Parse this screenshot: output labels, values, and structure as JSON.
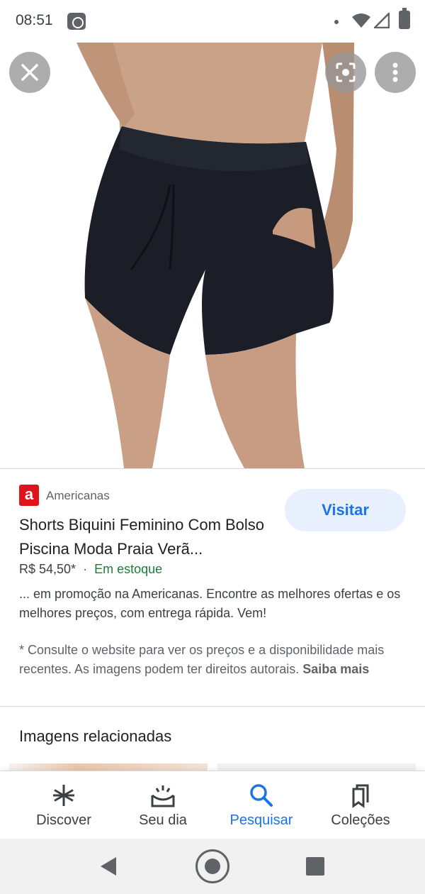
{
  "status_bar": {
    "time": "08:51"
  },
  "image_viewer": {
    "close_icon": "close-icon",
    "lens_icon": "lens-icon",
    "more_icon": "more-vert-icon"
  },
  "result": {
    "source": {
      "logo_text": "a",
      "logo_color": "#e1121a",
      "name": "Americanas"
    },
    "visit_label": "Visitar",
    "title": "Shorts Biquini Feminino Com Bolso Piscina Moda Praia Verã...",
    "price": "R$ 54,50*",
    "separator": "·",
    "stock": "Em estoque",
    "snippet": "... em promoção na Americanas. Encontre as melhores ofertas e os melhores preços, com entrega rápida. Vem!",
    "disclaimer": "* Consulte o website para ver os preços e a disponibilidade mais recentes. As imagens podem ter direitos autorais.",
    "learn_more": "Saiba mais"
  },
  "related": {
    "title": "Imagens relacionadas"
  },
  "bottom_nav": {
    "items": [
      {
        "label": "Discover",
        "icon": "asterisk-icon"
      },
      {
        "label": "Seu dia",
        "icon": "sunrise-icon"
      },
      {
        "label": "Pesquisar",
        "icon": "search-icon"
      },
      {
        "label": "Coleções",
        "icon": "collections-icon"
      }
    ],
    "active_index": 2,
    "active_color": "#1a73e8"
  }
}
